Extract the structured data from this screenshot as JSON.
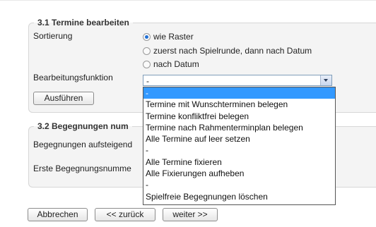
{
  "section31": {
    "title": "3.1 Termine bearbeiten",
    "sort_label": "Sortierung",
    "sort_options": [
      {
        "label": "wie Raster",
        "checked": true
      },
      {
        "label": "zuerst nach Spielrunde, dann nach Datum",
        "checked": false
      },
      {
        "label": "nach Datum",
        "checked": false
      }
    ],
    "function_label": "Bearbeitungsfunktion",
    "function_value": "-",
    "execute_button": "Ausführen"
  },
  "section32": {
    "title_visible": "3.2 Begegnungen num",
    "row1_label": "Begegnungen aufsteigend",
    "row2_label": "Erste Begegnungsnumme"
  },
  "dropdown": {
    "items": [
      "-",
      "Termine mit Wunschterminen belegen",
      "Termine konfliktfrei belegen",
      "Termine nach Rahmenterminplan belegen",
      "Alle Termine auf leer setzen",
      "-",
      "Alle Termine fixieren",
      "Alle Fixierungen aufheben",
      "-",
      "Spielfreie Begegnungen löschen"
    ]
  },
  "footer": {
    "cancel": "Abbrechen",
    "back": "<< zurück",
    "next": "weiter >>"
  },
  "colors": {
    "selection": "#3399ff",
    "panel": "#f4f4f4",
    "radio_dot": "#1f6fd6"
  }
}
